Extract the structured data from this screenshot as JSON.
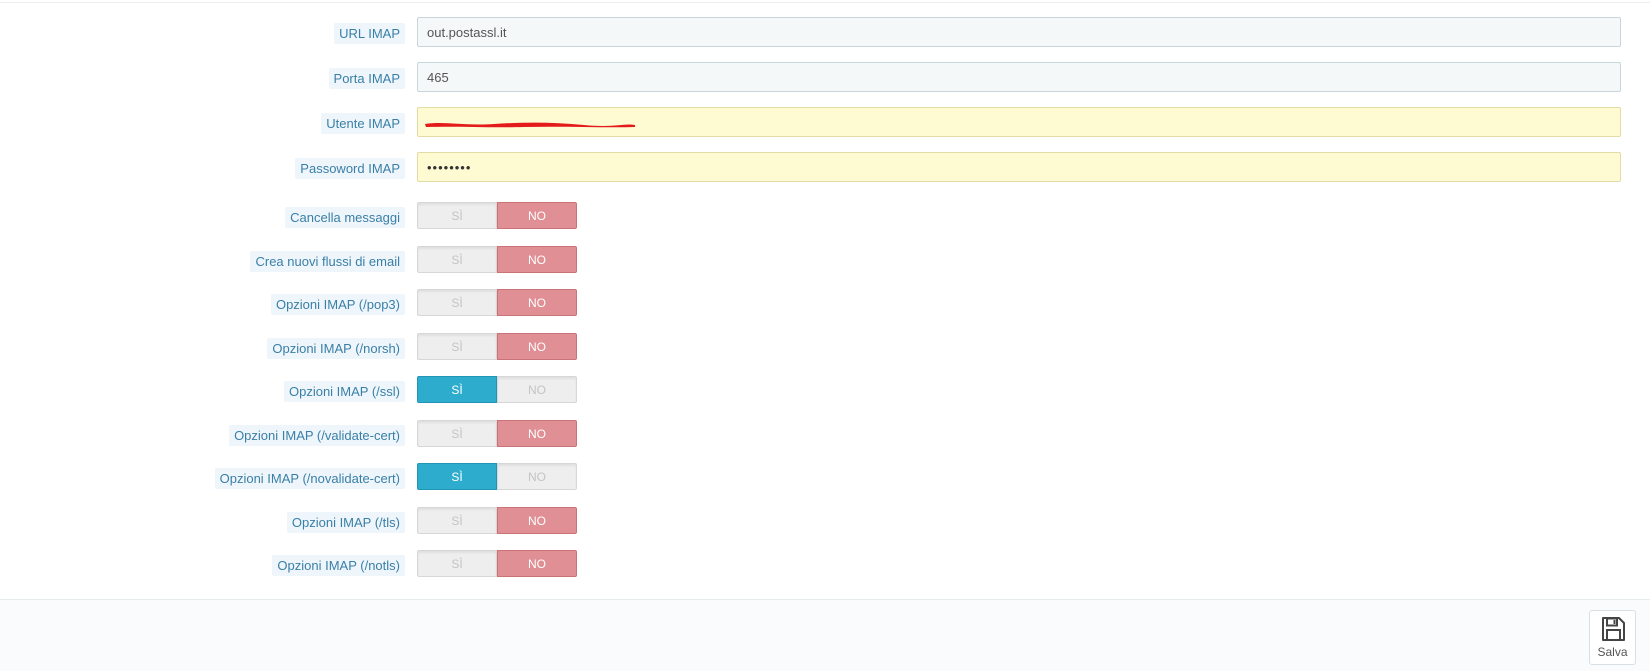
{
  "fields": {
    "url": {
      "label": "URL IMAP",
      "value": "out.postassl.it"
    },
    "port": {
      "label": "Porta IMAP",
      "value": "465"
    },
    "user": {
      "label": "Utente IMAP",
      "value": ""
    },
    "password": {
      "label": "Passoword IMAP",
      "value": "••••••••"
    }
  },
  "switches": [
    {
      "label": "Cancella messaggi",
      "yes": "SÌ",
      "no": "NO",
      "selected": "no"
    },
    {
      "label": "Crea nuovi flussi di email",
      "yes": "SÌ",
      "no": "NO",
      "selected": "no"
    },
    {
      "label": "Opzioni IMAP (/pop3)",
      "yes": "SÌ",
      "no": "NO",
      "selected": "no"
    },
    {
      "label": "Opzioni IMAP (/norsh)",
      "yes": "SÌ",
      "no": "NO",
      "selected": "no"
    },
    {
      "label": "Opzioni IMAP (/ssl)",
      "yes": "SÌ",
      "no": "NO",
      "selected": "yes"
    },
    {
      "label": "Opzioni IMAP (/validate-cert)",
      "yes": "SÌ",
      "no": "NO",
      "selected": "no"
    },
    {
      "label": "Opzioni IMAP (/novalidate-cert)",
      "yes": "SÌ",
      "no": "NO",
      "selected": "yes"
    },
    {
      "label": "Opzioni IMAP (/tls)",
      "yes": "SÌ",
      "no": "NO",
      "selected": "no"
    },
    {
      "label": "Opzioni IMAP (/notls)",
      "yes": "SÌ",
      "no": "NO",
      "selected": "no"
    }
  ],
  "footer": {
    "save_label": "Salva",
    "save_icon": "floppy-disk-icon"
  },
  "colors": {
    "yes_active": "#2eacce",
    "no_active": "#e08f95",
    "label_bg": "#eef6fb",
    "label_text": "#3a7fa7",
    "autofill_bg": "#fefad2",
    "redaction": "#e31b1b"
  }
}
